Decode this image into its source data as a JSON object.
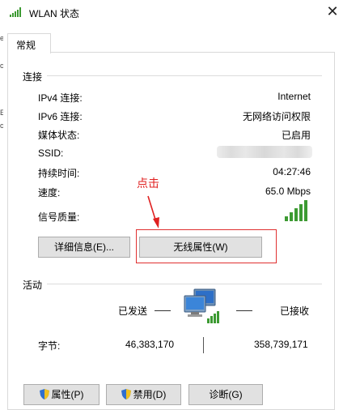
{
  "window": {
    "title": "WLAN 状态",
    "close_glyph": "✕"
  },
  "left_edge": [
    "e",
    "c",
    "E",
    "c"
  ],
  "tabs": [
    {
      "label": "常规"
    }
  ],
  "connection": {
    "section_title": "连接",
    "rows": [
      {
        "label": "IPv4 连接:",
        "value": "Internet"
      },
      {
        "label": "IPv6 连接:",
        "value": "无网络访问权限"
      },
      {
        "label": "媒体状态:",
        "value": "已启用"
      },
      {
        "label": "SSID:",
        "value": ""
      },
      {
        "label": "持续时间:",
        "value": "04:27:46"
      },
      {
        "label": "速度:",
        "value": "65.0 Mbps"
      },
      {
        "label": "信号质量:",
        "value": ""
      }
    ],
    "signal_bars_lit": 5,
    "signal_bars_total": 5,
    "details_button": "详细信息(E)...",
    "wireless_button": "无线属性(W)"
  },
  "annotation": {
    "text": "点击",
    "color": "#e02020"
  },
  "activity": {
    "section_title": "活动",
    "sent_label": "已发送",
    "received_label": "已接收",
    "bytes_label": "字节:",
    "bytes_sent": "46,383,170",
    "bytes_received": "358,739,171"
  },
  "bottom_buttons": {
    "properties": "属性(P)",
    "disable": "禁用(D)",
    "diagnose": "诊断(G)"
  },
  "colors": {
    "signal_green": "#3c9a32",
    "accent_red": "#e02020"
  }
}
